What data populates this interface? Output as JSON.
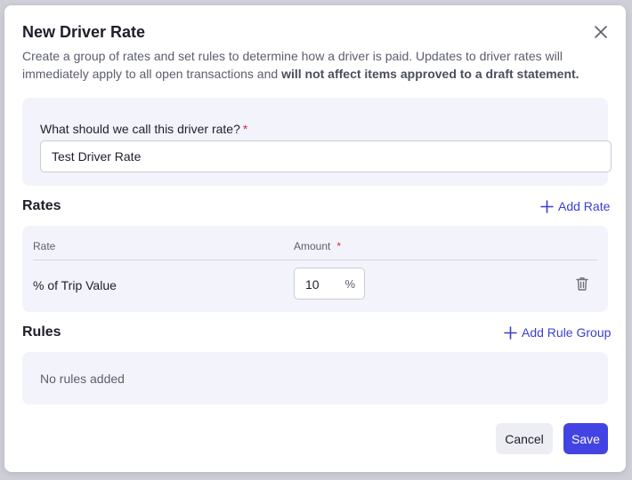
{
  "dialog": {
    "title": "New Driver Rate",
    "description_plain": "Create a group of rates and set rules to determine how a driver is paid. Updates to driver rates will immediately apply to all open transactions and ",
    "description_bold": "will not affect items approved to a draft statement."
  },
  "name_field": {
    "label": "What should we call this driver rate?",
    "required_mark": "*",
    "value": "Test Driver Rate"
  },
  "rates": {
    "title": "Rates",
    "add_label": "Add Rate",
    "columns": {
      "rate": "Rate",
      "amount": "Amount",
      "amount_required": "*"
    },
    "rows": [
      {
        "rate": "% of Trip Value",
        "amount": "10",
        "unit": "%"
      }
    ]
  },
  "rules": {
    "title": "Rules",
    "add_label": "Add Rule Group",
    "empty_text": "No rules added"
  },
  "footer": {
    "cancel_label": "Cancel",
    "save_label": "Save"
  },
  "colors": {
    "accent": "#3b3fd1",
    "primary_button": "#4343e3",
    "required": "#d6283b",
    "card_background": "#f3f4fb"
  },
  "icons": {
    "close": "close-icon",
    "add": "plus-icon",
    "delete": "trash-icon"
  }
}
